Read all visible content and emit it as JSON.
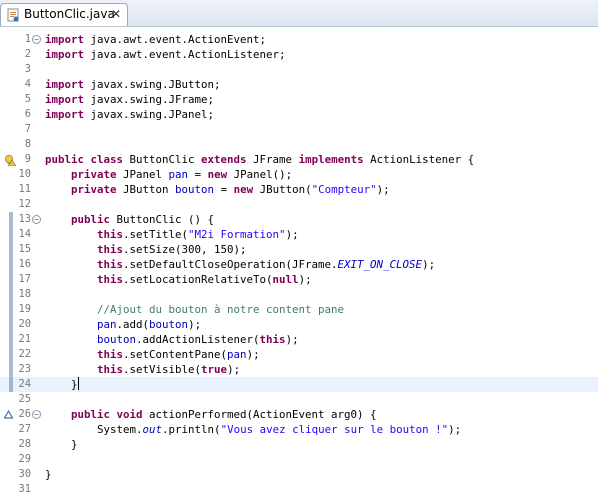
{
  "tab": {
    "title": "ButtonClic.java",
    "close_glyph": "✕",
    "icon": "java-file-icon"
  },
  "editor": {
    "line_numbers": [
      "1",
      "2",
      "3",
      "4",
      "5",
      "6",
      "7",
      "8",
      "9",
      "10",
      "11",
      "12",
      "13",
      "14",
      "15",
      "16",
      "17",
      "18",
      "19",
      "20",
      "21",
      "22",
      "23",
      "24",
      "25",
      "26",
      "27",
      "28",
      "29",
      "30",
      "31"
    ],
    "markers": {
      "line9": "warning-lightbulb-icon",
      "line26": "override-triangle-icon"
    },
    "code": {
      "l1_kw": "import",
      "l1_rest": " java.awt.event.ActionEvent;",
      "l2_kw": "import",
      "l2_rest": " java.awt.event.ActionListener;",
      "l4_kw": "import",
      "l4_rest": " javax.swing.JButton;",
      "l5_kw": "import",
      "l5_rest": " javax.swing.JFrame;",
      "l6_kw": "import",
      "l6_rest": " javax.swing.JPanel;",
      "l9_kw1": "public class",
      "l9_t1": " ButtonClic ",
      "l9_kw2": "extends",
      "l9_t2": " JFrame ",
      "l9_kw3": "implements",
      "l9_t3": " ActionListener {",
      "l10_ind": "    ",
      "l10_kw1": "private",
      "l10_t1": " JPanel ",
      "l10_f": "pan",
      "l10_t2": " = ",
      "l10_kw2": "new",
      "l10_t3": " JPanel();",
      "l11_ind": "    ",
      "l11_kw1": "private",
      "l11_t1": " JButton ",
      "l11_f": "bouton",
      "l11_t2": " = ",
      "l11_kw2": "new",
      "l11_t3": " JButton(",
      "l11_s": "\"Compteur\"",
      "l11_t4": ");",
      "l13_ind": "    ",
      "l13_kw": "public",
      "l13_t": " ButtonClic () {",
      "l14_ind": "        ",
      "l14_kw": "this",
      "l14_t1": ".setTitle(",
      "l14_s": "\"M2i Formation\"",
      "l14_t2": ");",
      "l15_ind": "        ",
      "l15_kw": "this",
      "l15_t": ".setSize(300, 150);",
      "l16_ind": "        ",
      "l16_kw": "this",
      "l16_t1": ".setDefaultCloseOperation(JFrame.",
      "l16_f": "EXIT_ON_CLOSE",
      "l16_t2": ");",
      "l17_ind": "        ",
      "l17_kw": "this",
      "l17_t1": ".setLocationRelativeTo(",
      "l17_kw2": "null",
      "l17_t2": ");",
      "l19_ind": "        ",
      "l19_c": "//Ajout du bouton à notre content pane",
      "l20_ind": "        ",
      "l20_f1": "pan",
      "l20_t1": ".add(",
      "l20_f2": "bouton",
      "l20_t2": ");",
      "l21_ind": "        ",
      "l21_f": "bouton",
      "l21_t1": ".addActionListener(",
      "l21_kw": "this",
      "l21_t2": ");",
      "l22_ind": "        ",
      "l22_kw": "this",
      "l22_t1": ".setContentPane(",
      "l22_f": "pan",
      "l22_t2": ");",
      "l23_ind": "        ",
      "l23_kw": "this",
      "l23_t1": ".setVisible(",
      "l23_kw2": "true",
      "l23_t2": ");",
      "l24_ind": "    ",
      "l24_t": "}",
      "l26_ind": "    ",
      "l26_kw1": "public void",
      "l26_t": " actionPerformed(ActionEvent arg0) {",
      "l27_ind": "        ",
      "l27_t1": "System.",
      "l27_f": "out",
      "l27_t2": ".println(",
      "l27_s": "\"Vous avez cliquer sur le bouton !\"",
      "l27_t3": ");",
      "l28_ind": "    ",
      "l28_t": "}",
      "l30_t": "}"
    }
  },
  "colors": {
    "keyword": "#7f0055",
    "string": "#2a00ff",
    "field": "#0000c0",
    "comment": "#3f7f5f",
    "line_number": "#787878"
  }
}
